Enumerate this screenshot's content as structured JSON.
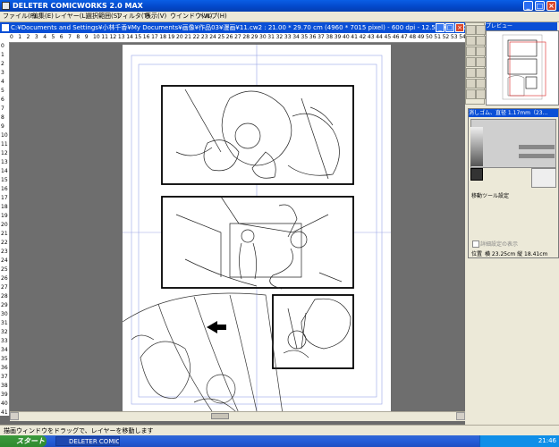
{
  "app": {
    "title": "DELETER COMICWORKS  2.0 MAX",
    "min": "_",
    "max": "□",
    "close": "×"
  },
  "menu": [
    "ファイル(F)",
    "編集(E)",
    "レイヤー(L)",
    "選択範囲(S)",
    "フィルタ(T)",
    "表示(V)",
    "ウインドウ(W)",
    "ヘルプ(H)"
  ],
  "document": {
    "title": "C:¥Documents and Settings¥小林千香¥My Documents¥画像¥作品03¥漫画¥11.cw2 : 21.00 * 29.70 cm (4960 * 7015 pixel) - 600 dpi - 12.5%表示 - ス"
  },
  "ruler_top": [
    "0",
    "1",
    "2",
    "3",
    "4",
    "5",
    "6",
    "7",
    "8",
    "9",
    "10",
    "11",
    "12",
    "13",
    "14",
    "15",
    "16",
    "17",
    "18",
    "19",
    "20",
    "21",
    "22",
    "23",
    "24",
    "25",
    "26",
    "27",
    "28",
    "29",
    "30",
    "31",
    "32",
    "33",
    "34",
    "35",
    "36",
    "37",
    "38",
    "39",
    "40",
    "41",
    "42",
    "43",
    "44",
    "45",
    "46",
    "47",
    "48",
    "49",
    "50",
    "51",
    "52",
    "53",
    "54",
    "55"
  ],
  "ruler_left": [
    "0",
    "1",
    "2",
    "3",
    "4",
    "5",
    "6",
    "7",
    "8",
    "9",
    "10",
    "11",
    "12",
    "13",
    "14",
    "15",
    "16",
    "17",
    "18",
    "19",
    "20",
    "21",
    "22",
    "23",
    "24",
    "25",
    "26",
    "27",
    "28",
    "29",
    "30",
    "31",
    "32",
    "33",
    "34",
    "35",
    "36",
    "37",
    "38",
    "39",
    "40",
    "41"
  ],
  "status": {
    "text": "描画ウィンドウをドラッグで、レイヤーを移動します"
  },
  "taskbar": {
    "start": "スタート",
    "task": "DELETER COMICWO...",
    "clock": "21:46"
  },
  "panels": {
    "preview_title": "プレビュー",
    "layer_title": "消しゴム、直径 1.17mm（23...",
    "tool_settings": "移動ツール設定",
    "detail_checkbox": "詳細設定の表示",
    "position_label": "位置",
    "position_value": "横 23.25cm 縦 18.41cm"
  }
}
